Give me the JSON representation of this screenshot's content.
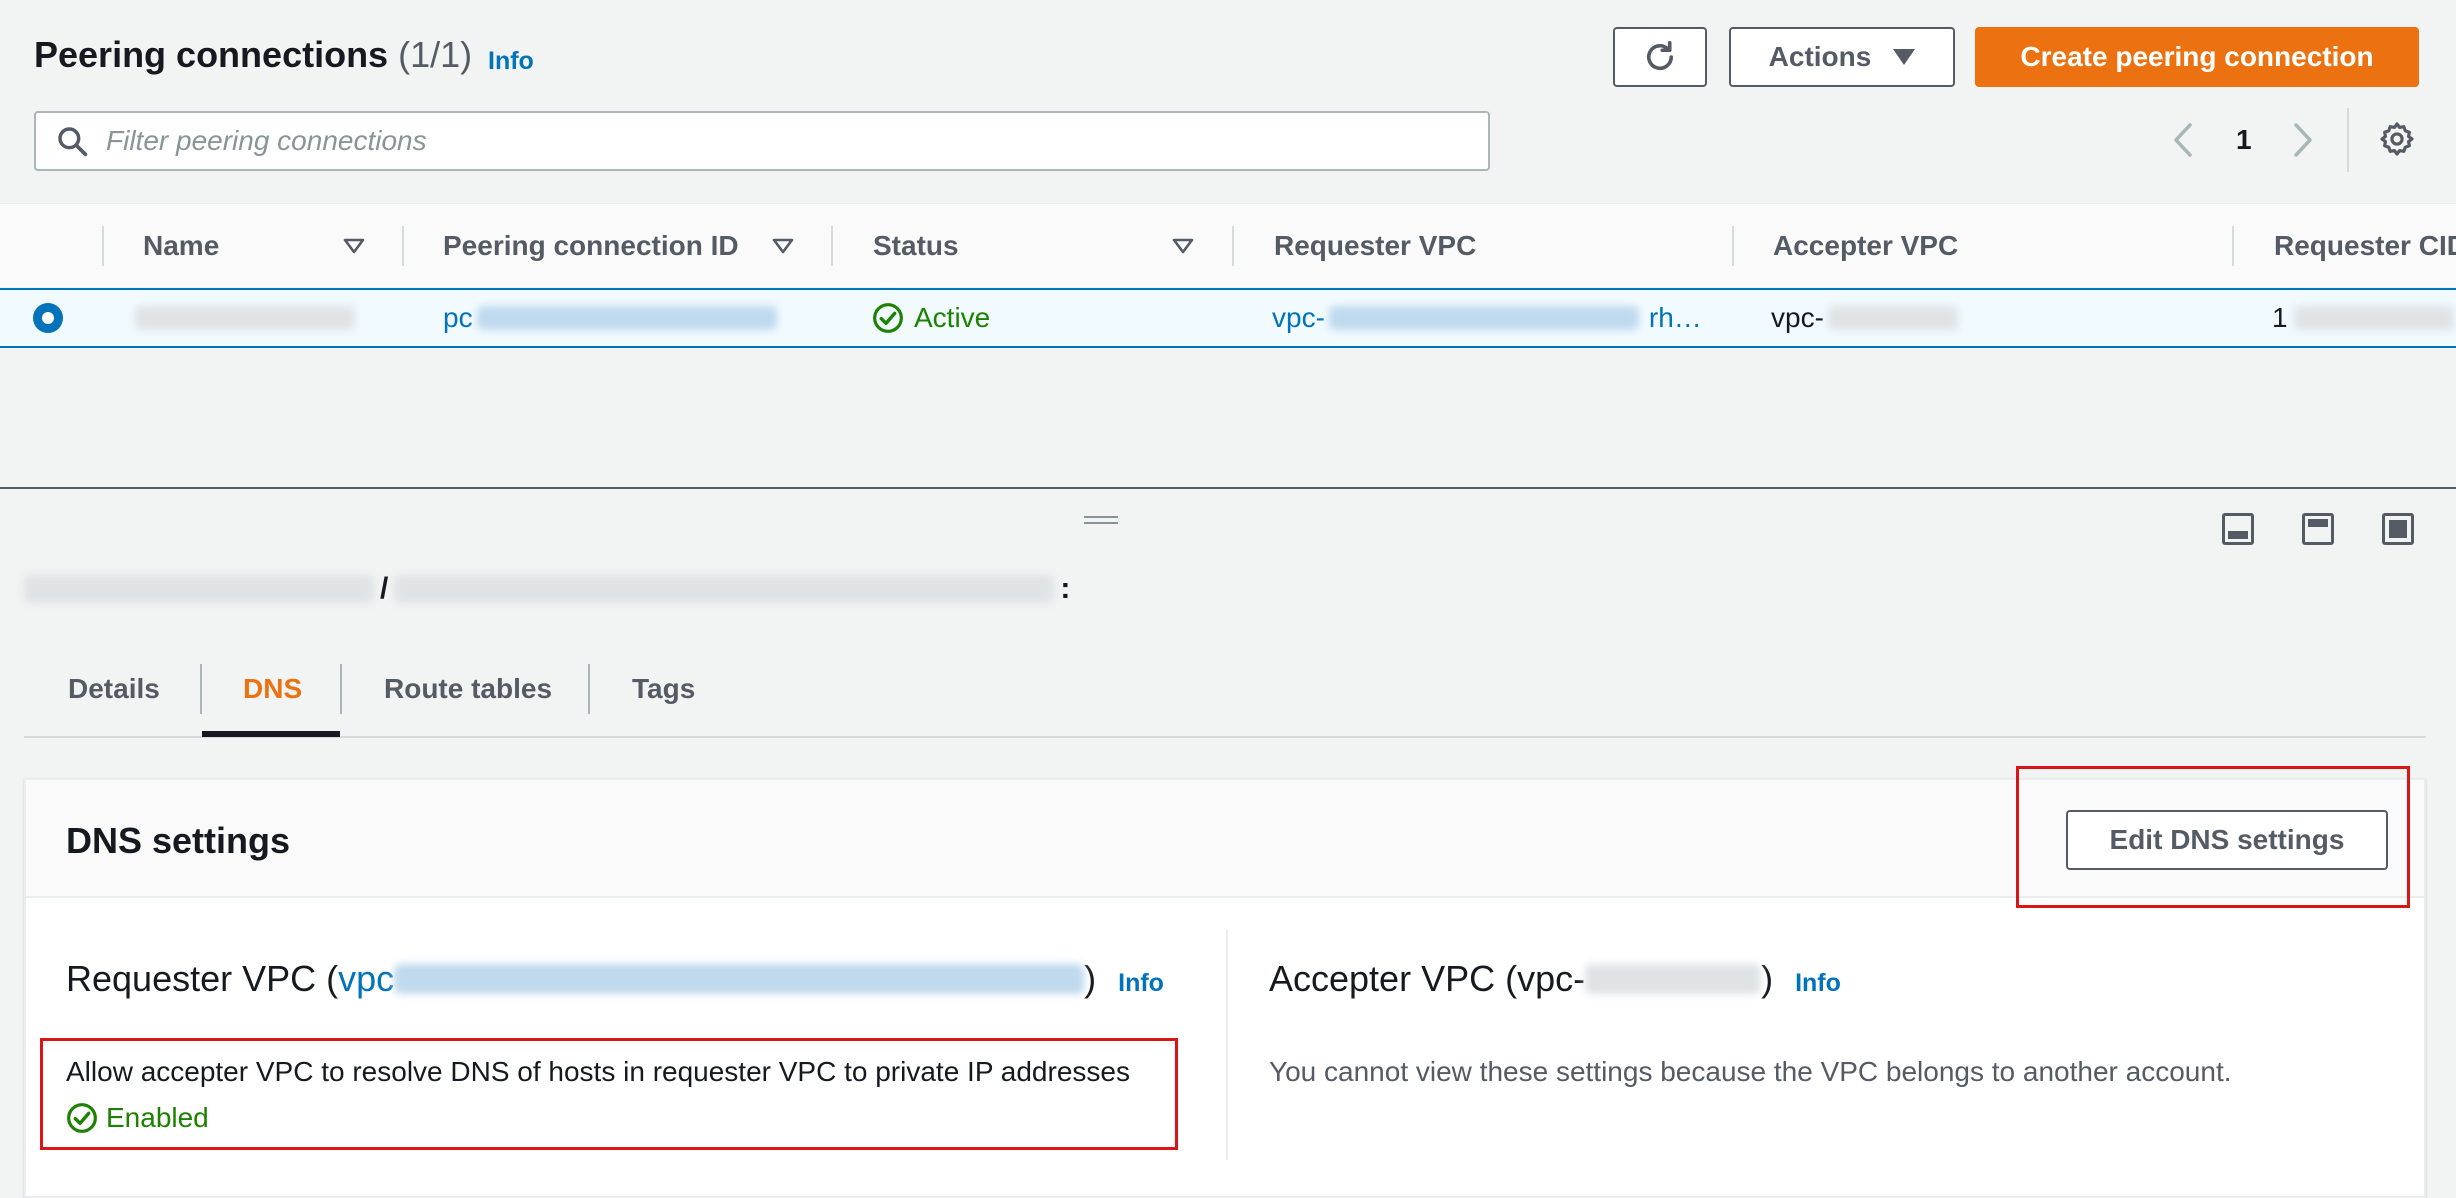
{
  "header": {
    "title": "Peering connections",
    "count": "(1/1)",
    "info_label": "Info",
    "actions_label": "Actions",
    "create_label": "Create peering connection"
  },
  "search": {
    "placeholder": "Filter peering connections"
  },
  "pagination": {
    "current_page": "1"
  },
  "table": {
    "columns": [
      "Name",
      "Peering connection ID",
      "Status",
      "Requester VPC",
      "Accepter VPC",
      "Requester CID"
    ],
    "rows": [
      {
        "name": "",
        "peering_id_prefix": "pc",
        "status": "Active",
        "requester_vpc_prefix": "vpc-",
        "requester_vpc_suffix": "rh…",
        "accepter_vpc_prefix": "vpc-",
        "requester_cidr_prefix": "1"
      }
    ]
  },
  "detail": {
    "title_separator": "/",
    "title_suffix": ":",
    "tabs": [
      "Details",
      "DNS",
      "Route tables",
      "Tags"
    ],
    "active_tab": "DNS"
  },
  "dns_card": {
    "title": "DNS settings",
    "edit_label": "Edit DNS settings",
    "requester": {
      "title_prefix": "Requester VPC (",
      "vpc_link_prefix": "vpc",
      "title_suffix": ")",
      "info_label": "Info",
      "setting_label": "Allow accepter VPC to resolve DNS of hosts in requester VPC to private IP addresses",
      "setting_value": "Enabled"
    },
    "accepter": {
      "title_prefix": "Accepter VPC (vpc-",
      "title_suffix": ")",
      "info_label": "Info",
      "message": "You cannot view these settings because the VPC belongs to another account."
    }
  },
  "colors": {
    "primary": "#ec7211",
    "link": "#0073bb",
    "success": "#1d8102",
    "highlight": "#d91515"
  }
}
